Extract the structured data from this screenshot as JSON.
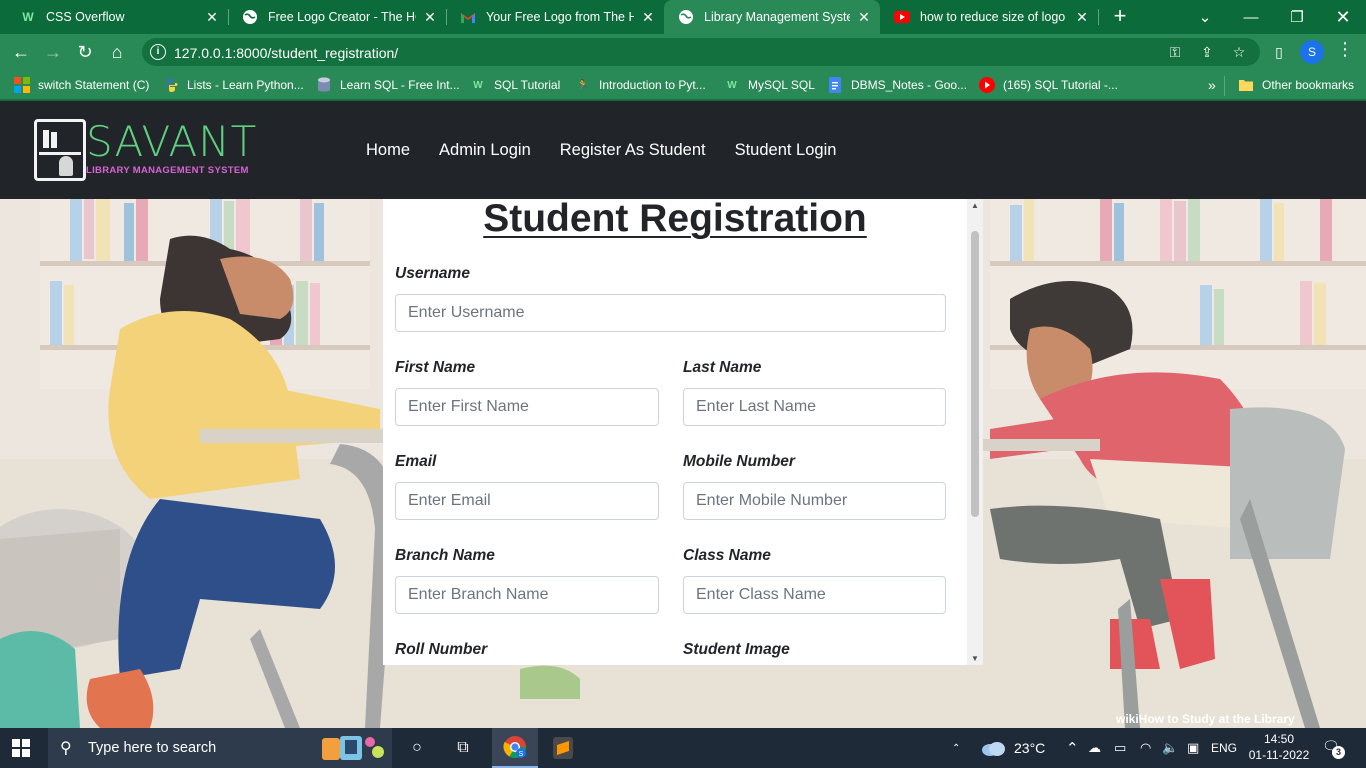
{
  "browser": {
    "tabs": [
      {
        "title": "CSS Overflow",
        "icon": "w3schools-icon",
        "active": false
      },
      {
        "title": "Free Logo Creator - The HOT",
        "icon": "globe-icon",
        "active": false
      },
      {
        "title": "Your Free Logo from The HOT",
        "icon": "gmail-icon",
        "active": false
      },
      {
        "title": "Library Management System",
        "icon": "globe-icon",
        "active": true
      },
      {
        "title": "how to reduce size of logo - ",
        "icon": "youtube-icon",
        "active": false
      }
    ],
    "new_tab_symbol": "+",
    "url": "127.0.0.1:8000/student_registration/",
    "profile_initial": "S",
    "bookmarks": [
      {
        "label": "switch Statement (C)",
        "icon": "windows-icon"
      },
      {
        "label": "Lists - Learn Python...",
        "icon": "python-icon"
      },
      {
        "label": "Learn SQL - Free Int...",
        "icon": "database-icon"
      },
      {
        "label": "SQL Tutorial",
        "icon": "w3schools-icon"
      },
      {
        "label": "Introduction to Pyt...",
        "icon": "runner-icon"
      },
      {
        "label": "MySQL SQL",
        "icon": "w3schools-icon"
      },
      {
        "label": "DBMS_Notes - Goo...",
        "icon": "docs-icon"
      },
      {
        "label": "(165) SQL Tutorial -...",
        "icon": "youtube-icon"
      }
    ],
    "bookmarks_overflow": "»",
    "other_bookmarks": "Other bookmarks"
  },
  "site": {
    "brand": "SAVANT",
    "tagline": "LIBRARY MANAGEMENT SYSTEM",
    "nav": [
      "Home",
      "Admin Login",
      "Register As Student",
      "Student Login"
    ],
    "watermark": "wikiHow to Study at the Library"
  },
  "form": {
    "title": "Student Registration",
    "fields": {
      "username": {
        "label": "Username",
        "placeholder": "Enter Username"
      },
      "first_name": {
        "label": "First Name",
        "placeholder": "Enter First Name"
      },
      "last_name": {
        "label": "Last Name",
        "placeholder": "Enter Last Name"
      },
      "email": {
        "label": "Email",
        "placeholder": "Enter Email"
      },
      "mobile": {
        "label": "Mobile Number",
        "placeholder": "Enter Mobile Number"
      },
      "branch": {
        "label": "Branch Name",
        "placeholder": "Enter Branch Name"
      },
      "class_name": {
        "label": "Class Name",
        "placeholder": "Enter Class Name"
      },
      "roll": {
        "label": "Roll Number"
      },
      "image": {
        "label": "Student Image"
      }
    }
  },
  "taskbar": {
    "search_placeholder": "Type here to search",
    "weather": "23°C",
    "language": "ENG",
    "time": "14:50",
    "date": "01-11-2022",
    "notification_count": "3"
  }
}
